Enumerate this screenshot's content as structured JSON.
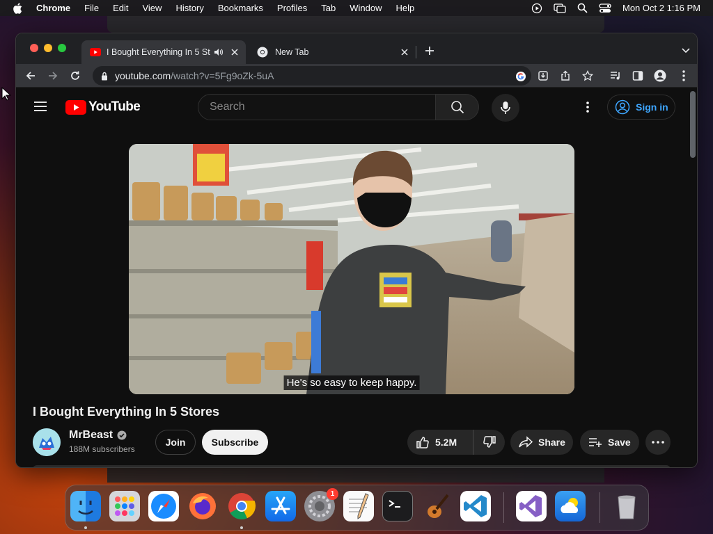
{
  "menubar": {
    "app_name": "Chrome",
    "items": [
      "File",
      "Edit",
      "View",
      "History",
      "Bookmarks",
      "Profiles",
      "Tab",
      "Window",
      "Help"
    ],
    "datetime": "Mon Oct 2  1:16 PM"
  },
  "browser": {
    "tabs": [
      {
        "title": "I Bought Everything In 5 St",
        "favicon": "youtube-icon",
        "audio": true
      },
      {
        "title": "New Tab",
        "favicon": "chrome-icon",
        "audio": false
      }
    ],
    "url_host": "youtube.com",
    "url_path": "/watch?v=5Fg9oZk-5uA"
  },
  "youtube": {
    "logo_text": "YouTube",
    "search_placeholder": "Search",
    "sign_in_label": "Sign in",
    "caption": "He's so easy to keep happy.",
    "video_title": "I Bought Everything In 5 Stores",
    "channel_name": "MrBeast",
    "subscribers": "188M subscribers",
    "join_label": "Join",
    "subscribe_label": "Subscribe",
    "like_count": "5.2M",
    "share_label": "Share",
    "save_label": "Save"
  },
  "dock": {
    "apps": [
      "finder-icon",
      "launchpad-icon",
      "safari-icon",
      "firefox-icon",
      "chrome-icon",
      "app-store-icon",
      "system-settings-icon",
      "textedit-icon",
      "terminal-icon",
      "garageband-icon",
      "vscode-icon",
      "visual-studio-icon",
      "weather-icon",
      "trash-icon"
    ],
    "settings_badge": "1"
  },
  "colors": {
    "youtube_red": "#ff0000",
    "link_blue": "#3ea6ff",
    "yt_background": "#0f0f0f",
    "chrome_toolbar": "#35363a"
  }
}
